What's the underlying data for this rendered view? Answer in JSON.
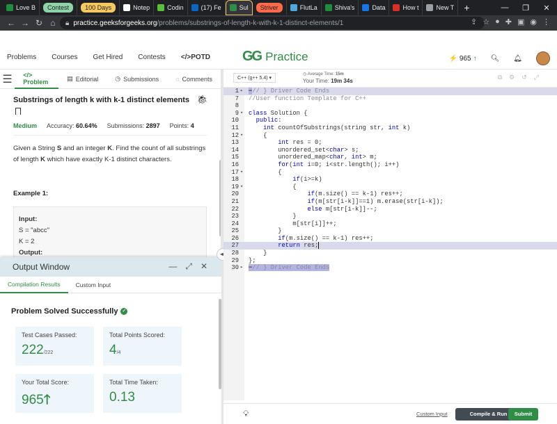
{
  "browser": {
    "tabs": [
      {
        "label": "Love B",
        "color": "#1e8e3e",
        "style": "plain"
      },
      {
        "label": "Contest",
        "color": "#8fd3a8",
        "style": "pill"
      },
      {
        "label": "100 Days",
        "color": "#f6c85f",
        "style": "pill"
      },
      {
        "label": "Notep",
        "color": "#ffffff",
        "style": "plain"
      },
      {
        "label": "Codin",
        "color": "#5bbf3a",
        "style": "plain"
      },
      {
        "label": "(17) Fe",
        "color": "#0a66c2",
        "style": "plain"
      },
      {
        "label": "Sul",
        "color": "#2f8d46",
        "style": "active"
      },
      {
        "label": "Striver",
        "color": "#ff6b4a",
        "style": "pill"
      },
      {
        "label": "FlutLa",
        "color": "#4ea8de",
        "style": "plain"
      },
      {
        "label": "Shiva's",
        "color": "#1e8e3e",
        "style": "plain"
      },
      {
        "label": "Data",
        "color": "#1a73e8",
        "style": "plain"
      },
      {
        "label": "How t",
        "color": "#d93025",
        "style": "plain"
      },
      {
        "label": "New T",
        "color": "#9aa0a6",
        "style": "plain"
      }
    ],
    "new_tab": "+",
    "url_host": "practice.geeksforgeeks.org",
    "url_path": "/problems/substrings-of-length-k-with-k-1-distinct-elements/1"
  },
  "header": {
    "menu": [
      "Problems",
      "Courses",
      "Get Hired",
      "Contests",
      "</>POTD"
    ],
    "logo_mark": "GG",
    "logo_text": "Practice",
    "streak": "965"
  },
  "problem": {
    "tabs": [
      "</> Problem",
      "Editorial",
      "Submissions",
      "Comments"
    ],
    "title": "Substrings of length k with k-1 distinct elements",
    "difficulty": "Medium",
    "accuracy_label": "Accuracy:",
    "accuracy": "60.64%",
    "submissions_label": "Submissions:",
    "submissions": "2897",
    "points_label": "Points:",
    "points": "4",
    "description": [
      {
        "text": "Given a String ",
        "bold": false
      },
      {
        "text": "S",
        "bold": true
      },
      {
        "text": " and an integer ",
        "bold": false
      },
      {
        "text": "K",
        "bold": true
      },
      {
        "text": ". Find the count of all substrings of length ",
        "bold": false
      },
      {
        "text": "K",
        "bold": true
      },
      {
        "text": " which have exactly K-1 distinct characters.",
        "bold": false
      }
    ],
    "example_title": "Example 1:",
    "example_lines": [
      {
        "text": "Input:",
        "bold": true
      },
      {
        "text": "S = \"abcc\"",
        "bold": false
      },
      {
        "text": "K = 2",
        "bold": false
      },
      {
        "text": "Output:",
        "bold": true
      }
    ]
  },
  "output": {
    "title": "Output Window",
    "tabs": [
      "Compilation Results",
      "Custom Input"
    ],
    "status": "Problem Solved Successfully",
    "cards": [
      {
        "label": "Test Cases Passed:",
        "value": "222",
        "sub": "/222",
        "arrow": ""
      },
      {
        "label": "Total Points Scored:",
        "value": "4",
        "sub": "/4",
        "arrow": ""
      },
      {
        "label": "Your Total Score:",
        "value": "965",
        "sub": "",
        "arrow": "🡑"
      },
      {
        "label": "Total Time Taken:",
        "value": "0.13",
        "sub": "",
        "arrow": ""
      }
    ]
  },
  "editor": {
    "language": "C++ (g++ 5.4) ▾",
    "avg_time_label": "Average Time:",
    "avg_time": "15m",
    "your_time_label": "Your Time:",
    "your_time": "19m 34s",
    "code": [
      {
        "n": "1",
        "fold": "▸",
        "segs": [
          [
            "sel",
            "⋯"
          ],
          [
            "cm",
            "// } Driver Code Ends"
          ]
        ],
        "hl": true
      },
      {
        "n": "7",
        "fold": "",
        "segs": [
          [
            "cm",
            "//User function Template for C++"
          ]
        ]
      },
      {
        "n": "8",
        "fold": "",
        "segs": []
      },
      {
        "n": "9",
        "fold": "▾",
        "segs": [
          [
            "kw",
            "class"
          ],
          [
            "",
            " Solution {"
          ]
        ]
      },
      {
        "n": "10",
        "fold": "",
        "segs": [
          [
            "",
            "  "
          ],
          [
            "kw",
            "public"
          ],
          [
            "",
            ":"
          ]
        ]
      },
      {
        "n": "11",
        "fold": "",
        "segs": [
          [
            "",
            "    "
          ],
          [
            "kw",
            "int"
          ],
          [
            "",
            " countOfSubstrings(string str, "
          ],
          [
            "kw",
            "int"
          ],
          [
            "",
            " k)"
          ]
        ]
      },
      {
        "n": "12",
        "fold": "▾",
        "segs": [
          [
            "",
            "    {"
          ]
        ]
      },
      {
        "n": "13",
        "fold": "",
        "segs": [
          [
            "",
            "        "
          ],
          [
            "kw",
            "int"
          ],
          [
            "",
            " res = 0;"
          ]
        ]
      },
      {
        "n": "14",
        "fold": "",
        "segs": [
          [
            "",
            "        unordered_set<"
          ],
          [
            "kw",
            "char"
          ],
          [
            "",
            "> s;"
          ]
        ]
      },
      {
        "n": "15",
        "fold": "",
        "segs": [
          [
            "",
            "        unordered_map<"
          ],
          [
            "kw",
            "char"
          ],
          [
            "",
            ", "
          ],
          [
            "kw",
            "int"
          ],
          [
            "",
            "> m;"
          ]
        ]
      },
      {
        "n": "16",
        "fold": "",
        "segs": [
          [
            "",
            "        "
          ],
          [
            "kw",
            "for"
          ],
          [
            "",
            "("
          ],
          [
            "kw",
            "int"
          ],
          [
            "",
            " i=0; i<str.length(); i++)"
          ]
        ]
      },
      {
        "n": "17",
        "fold": "▾",
        "segs": [
          [
            "",
            "        {"
          ]
        ]
      },
      {
        "n": "18",
        "fold": "",
        "segs": [
          [
            "",
            "            "
          ],
          [
            "kw",
            "if"
          ],
          [
            "",
            "(i>=k)"
          ]
        ]
      },
      {
        "n": "19",
        "fold": "▾",
        "segs": [
          [
            "",
            "            {"
          ]
        ]
      },
      {
        "n": "20",
        "fold": "",
        "segs": [
          [
            "",
            "                "
          ],
          [
            "kw",
            "if"
          ],
          [
            "",
            "(m.size() == k-1) res++;"
          ]
        ]
      },
      {
        "n": "21",
        "fold": "",
        "segs": [
          [
            "",
            "                "
          ],
          [
            "kw",
            "if"
          ],
          [
            "",
            "(m[str[i-k]]==1) m.erase(str[i-k]);"
          ]
        ]
      },
      {
        "n": "22",
        "fold": "",
        "segs": [
          [
            "",
            "                "
          ],
          [
            "kw",
            "else"
          ],
          [
            "",
            " m[str[i-k]]--;"
          ]
        ]
      },
      {
        "n": "23",
        "fold": "",
        "segs": [
          [
            "",
            "            }"
          ]
        ]
      },
      {
        "n": "24",
        "fold": "",
        "segs": [
          [
            "",
            "            m[str[i]]++;"
          ]
        ]
      },
      {
        "n": "25",
        "fold": "",
        "segs": [
          [
            "",
            "        }"
          ]
        ]
      },
      {
        "n": "26",
        "fold": "",
        "segs": [
          [
            "",
            "        "
          ],
          [
            "kw",
            "if"
          ],
          [
            "",
            "(m.size() == k-1) res++;"
          ]
        ]
      },
      {
        "n": "27",
        "fold": "",
        "segs": [
          [
            "",
            "        "
          ],
          [
            "kw",
            "return"
          ],
          [
            "",
            " res;"
          ],
          [
            "cur",
            ""
          ]
        ],
        "hl": true
      },
      {
        "n": "28",
        "fold": "",
        "segs": [
          [
            "",
            "    }"
          ]
        ]
      },
      {
        "n": "29",
        "fold": "",
        "segs": [
          [
            "",
            "};"
          ]
        ]
      },
      {
        "n": "30",
        "fold": "▸",
        "segs": [
          [
            "sel",
            "⋯"
          ],
          [
            "cm sel",
            "// } Driver Code Ends"
          ]
        ]
      }
    ],
    "custom_input": "Custom Input",
    "compile_run": "Compile & Run",
    "submit": "Submit"
  }
}
